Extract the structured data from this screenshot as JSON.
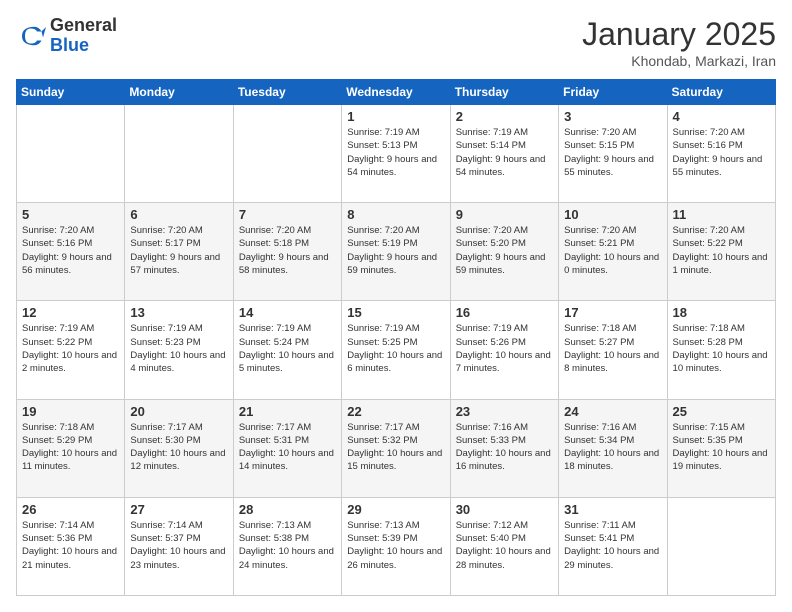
{
  "logo": {
    "general": "General",
    "blue": "Blue"
  },
  "header": {
    "title": "January 2025",
    "subtitle": "Khondab, Markazi, Iran"
  },
  "days_of_week": [
    "Sunday",
    "Monday",
    "Tuesday",
    "Wednesday",
    "Thursday",
    "Friday",
    "Saturday"
  ],
  "weeks": [
    [
      {
        "day": null,
        "info": null
      },
      {
        "day": null,
        "info": null
      },
      {
        "day": null,
        "info": null
      },
      {
        "day": "1",
        "info": "Sunrise: 7:19 AM\nSunset: 5:13 PM\nDaylight: 9 hours and 54 minutes."
      },
      {
        "day": "2",
        "info": "Sunrise: 7:19 AM\nSunset: 5:14 PM\nDaylight: 9 hours and 54 minutes."
      },
      {
        "day": "3",
        "info": "Sunrise: 7:20 AM\nSunset: 5:15 PM\nDaylight: 9 hours and 55 minutes."
      },
      {
        "day": "4",
        "info": "Sunrise: 7:20 AM\nSunset: 5:16 PM\nDaylight: 9 hours and 55 minutes."
      }
    ],
    [
      {
        "day": "5",
        "info": "Sunrise: 7:20 AM\nSunset: 5:16 PM\nDaylight: 9 hours and 56 minutes."
      },
      {
        "day": "6",
        "info": "Sunrise: 7:20 AM\nSunset: 5:17 PM\nDaylight: 9 hours and 57 minutes."
      },
      {
        "day": "7",
        "info": "Sunrise: 7:20 AM\nSunset: 5:18 PM\nDaylight: 9 hours and 58 minutes."
      },
      {
        "day": "8",
        "info": "Sunrise: 7:20 AM\nSunset: 5:19 PM\nDaylight: 9 hours and 59 minutes."
      },
      {
        "day": "9",
        "info": "Sunrise: 7:20 AM\nSunset: 5:20 PM\nDaylight: 9 hours and 59 minutes."
      },
      {
        "day": "10",
        "info": "Sunrise: 7:20 AM\nSunset: 5:21 PM\nDaylight: 10 hours and 0 minutes."
      },
      {
        "day": "11",
        "info": "Sunrise: 7:20 AM\nSunset: 5:22 PM\nDaylight: 10 hours and 1 minute."
      }
    ],
    [
      {
        "day": "12",
        "info": "Sunrise: 7:19 AM\nSunset: 5:22 PM\nDaylight: 10 hours and 2 minutes."
      },
      {
        "day": "13",
        "info": "Sunrise: 7:19 AM\nSunset: 5:23 PM\nDaylight: 10 hours and 4 minutes."
      },
      {
        "day": "14",
        "info": "Sunrise: 7:19 AM\nSunset: 5:24 PM\nDaylight: 10 hours and 5 minutes."
      },
      {
        "day": "15",
        "info": "Sunrise: 7:19 AM\nSunset: 5:25 PM\nDaylight: 10 hours and 6 minutes."
      },
      {
        "day": "16",
        "info": "Sunrise: 7:19 AM\nSunset: 5:26 PM\nDaylight: 10 hours and 7 minutes."
      },
      {
        "day": "17",
        "info": "Sunrise: 7:18 AM\nSunset: 5:27 PM\nDaylight: 10 hours and 8 minutes."
      },
      {
        "day": "18",
        "info": "Sunrise: 7:18 AM\nSunset: 5:28 PM\nDaylight: 10 hours and 10 minutes."
      }
    ],
    [
      {
        "day": "19",
        "info": "Sunrise: 7:18 AM\nSunset: 5:29 PM\nDaylight: 10 hours and 11 minutes."
      },
      {
        "day": "20",
        "info": "Sunrise: 7:17 AM\nSunset: 5:30 PM\nDaylight: 10 hours and 12 minutes."
      },
      {
        "day": "21",
        "info": "Sunrise: 7:17 AM\nSunset: 5:31 PM\nDaylight: 10 hours and 14 minutes."
      },
      {
        "day": "22",
        "info": "Sunrise: 7:17 AM\nSunset: 5:32 PM\nDaylight: 10 hours and 15 minutes."
      },
      {
        "day": "23",
        "info": "Sunrise: 7:16 AM\nSunset: 5:33 PM\nDaylight: 10 hours and 16 minutes."
      },
      {
        "day": "24",
        "info": "Sunrise: 7:16 AM\nSunset: 5:34 PM\nDaylight: 10 hours and 18 minutes."
      },
      {
        "day": "25",
        "info": "Sunrise: 7:15 AM\nSunset: 5:35 PM\nDaylight: 10 hours and 19 minutes."
      }
    ],
    [
      {
        "day": "26",
        "info": "Sunrise: 7:14 AM\nSunset: 5:36 PM\nDaylight: 10 hours and 21 minutes."
      },
      {
        "day": "27",
        "info": "Sunrise: 7:14 AM\nSunset: 5:37 PM\nDaylight: 10 hours and 23 minutes."
      },
      {
        "day": "28",
        "info": "Sunrise: 7:13 AM\nSunset: 5:38 PM\nDaylight: 10 hours and 24 minutes."
      },
      {
        "day": "29",
        "info": "Sunrise: 7:13 AM\nSunset: 5:39 PM\nDaylight: 10 hours and 26 minutes."
      },
      {
        "day": "30",
        "info": "Sunrise: 7:12 AM\nSunset: 5:40 PM\nDaylight: 10 hours and 28 minutes."
      },
      {
        "day": "31",
        "info": "Sunrise: 7:11 AM\nSunset: 5:41 PM\nDaylight: 10 hours and 29 minutes."
      },
      {
        "day": null,
        "info": null
      }
    ]
  ]
}
